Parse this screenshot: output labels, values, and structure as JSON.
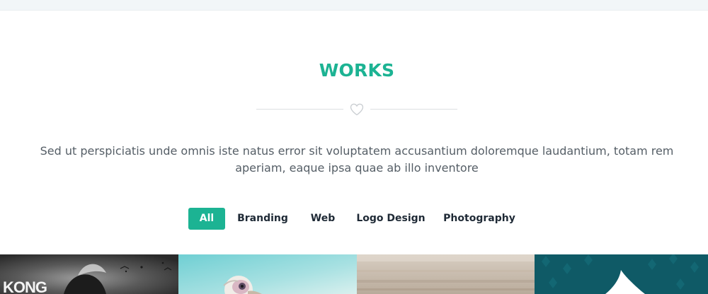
{
  "section": {
    "title": "WORKS",
    "divider_icon": "heart-icon",
    "description": "Sed ut perspiciatis unde omnis iste natus error sit voluptatem accusantium doloremque laudantium, totam rem aperiam, eaque ipsa quae ab illo inventore"
  },
  "filters": [
    {
      "label": "All",
      "active": true
    },
    {
      "label": "Branding",
      "active": false
    },
    {
      "label": "Web",
      "active": false
    },
    {
      "label": "Logo Design",
      "active": false
    },
    {
      "label": "Photography",
      "active": false
    }
  ],
  "portfolio": {
    "tiles": [
      {
        "overlay_text": "KONG",
        "subject": "grayscale-poster"
      },
      {
        "subject": "bird-illustration"
      },
      {
        "subject": "sand-texture"
      },
      {
        "subject": "teal-diamond-pattern"
      }
    ]
  },
  "colors": {
    "accent": "#1cb393",
    "text_dark": "#1f2a36",
    "text_body": "#555e66",
    "divider": "#dcdfe2"
  }
}
